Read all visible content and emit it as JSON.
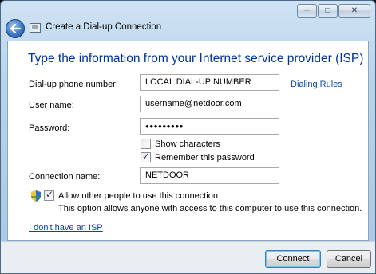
{
  "window": {
    "controls": {
      "minimize": "─",
      "maximize": "□",
      "close": "✕"
    }
  },
  "header": {
    "title": "Create a Dial-up Connection",
    "back_icon": "back-arrow-icon",
    "app_icon": "dialup-connection-icon"
  },
  "main": {
    "heading": "Type the information from your Internet service provider (ISP)",
    "phone": {
      "label": "Dial-up phone number:",
      "value": "LOCAL DIAL-UP NUMBER"
    },
    "dialing_rules": "Dialing Rules",
    "username": {
      "label": "User name:",
      "value": "username@netdoor.com"
    },
    "password": {
      "label": "Password:",
      "value": "●●●●●●●●●"
    },
    "show_characters": {
      "label": "Show characters",
      "checked": false
    },
    "remember_password": {
      "label": "Remember this password",
      "checked": true
    },
    "connection_name": {
      "label": "Connection name:",
      "value": "NETDOOR"
    },
    "allow_others": {
      "label": "Allow other people to use this connection",
      "checked": true,
      "description": "This option allows anyone with access to this computer to use this connection.",
      "icon": "uac-shield-icon"
    },
    "no_isp_link": "I don't have an ISP"
  },
  "footer": {
    "connect_label": "Connect",
    "cancel_label": "Cancel"
  },
  "colors": {
    "heading": "#003399",
    "link": "#0645ad",
    "titlebar": "#b9d3ea"
  }
}
